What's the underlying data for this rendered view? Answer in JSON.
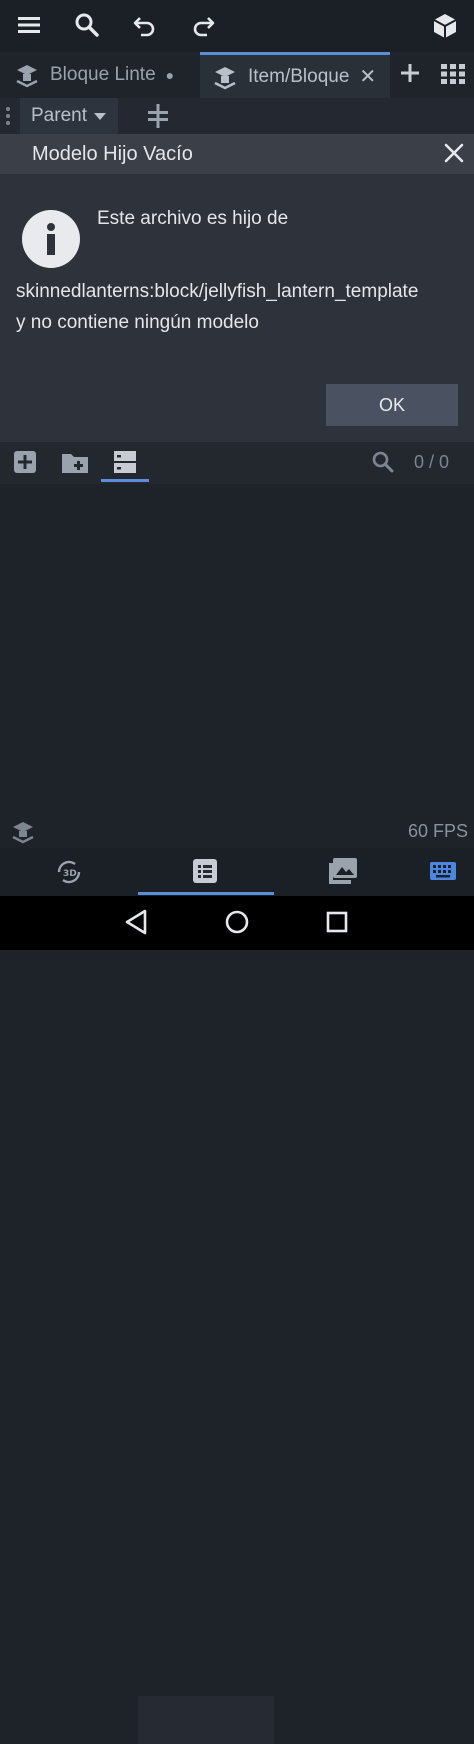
{
  "tabs": [
    {
      "label": "Bloque Linte",
      "modified_dot": "●"
    },
    {
      "label": "Item/Bloque",
      "close": "✕"
    }
  ],
  "subbar": {
    "parent_label": "Parent"
  },
  "dialog": {
    "title": "Modelo Hijo Vacío",
    "line1": "Este archivo es hijo de",
    "line2": "skinnedlanterns:block/jellyfish_lantern_template",
    "line3": "y no contiene ningún modelo",
    "ok_label": "OK"
  },
  "files": {
    "search_count": "0 / 0"
  },
  "status": {
    "fps": "60 FPS"
  },
  "colors": {
    "accent": "#5b8ed6",
    "dialog_bg": "#2e333b",
    "ok_button": "#4a5160"
  }
}
